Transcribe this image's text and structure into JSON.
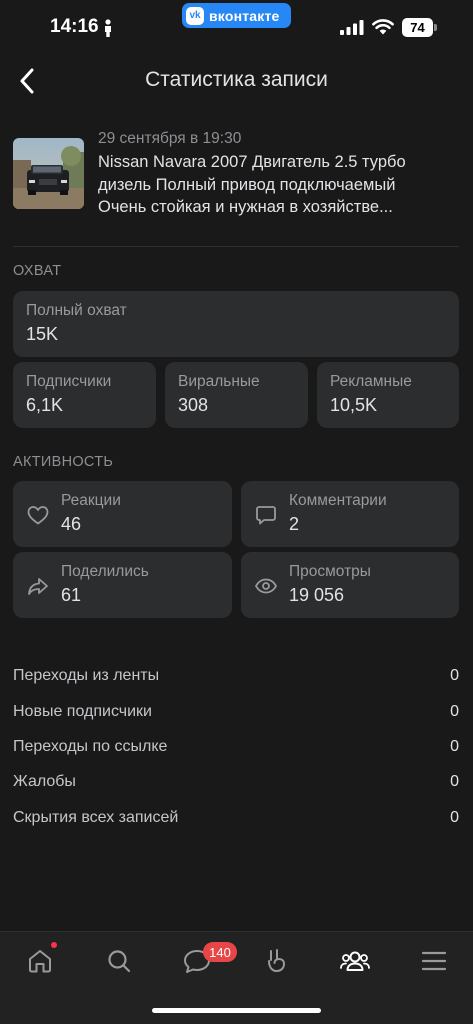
{
  "status_bar": {
    "time": "14:16",
    "app_pill": "вконтакте",
    "vk_logo": "vk",
    "battery": "74"
  },
  "header": {
    "title": "Статистика записи",
    "back_icon": "chevron-left-icon"
  },
  "post": {
    "date": "29 сентября в 19:30",
    "text": "Nissan Navara 2007 Двигатель 2.5 турбо дизель Полный привод подключаемый Очень стойкая и нужная в хозяйстве..."
  },
  "reach": {
    "section_title": "ОХВАТ",
    "total": {
      "label": "Полный охват",
      "value": "15K"
    },
    "subscribers": {
      "label": "Подписчики",
      "value": "6,1K"
    },
    "viral": {
      "label": "Виральные",
      "value": "308"
    },
    "ads": {
      "label": "Рекламные",
      "value": "10,5K"
    }
  },
  "activity": {
    "section_title": "АКТИВНОСТЬ",
    "reactions": {
      "label": "Реакции",
      "value": "46",
      "icon": "heart-icon"
    },
    "comments": {
      "label": "Комментарии",
      "value": "2",
      "icon": "comment-icon"
    },
    "shares": {
      "label": "Поделились",
      "value": "61",
      "icon": "share-icon"
    },
    "views": {
      "label": "Просмотры",
      "value": "19 056",
      "icon": "eye-icon"
    }
  },
  "metrics": [
    {
      "label": "Переходы из ленты",
      "value": "0"
    },
    {
      "label": "Новые подписчики",
      "value": "0"
    },
    {
      "label": "Переходы по ссылке",
      "value": "0"
    },
    {
      "label": "Жалобы",
      "value": "0"
    },
    {
      "label": "Скрытия всех записей",
      "value": "0"
    }
  ],
  "tab_bar": {
    "messages_badge": "140",
    "tabs": [
      "home-icon",
      "search-icon",
      "messages-icon",
      "clips-icon",
      "friends-icon",
      "menu-icon"
    ]
  },
  "colors": {
    "background": "#19191a",
    "card": "#2c2d2e",
    "accent": "#2787f5",
    "badge": "#e64646"
  }
}
